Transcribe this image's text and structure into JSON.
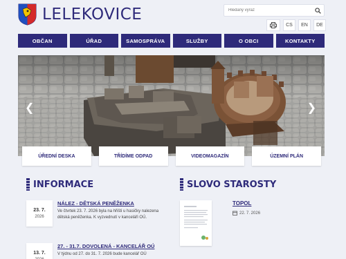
{
  "header": {
    "title": "LELEKOVICE",
    "search_placeholder": "Hledaný výraz",
    "languages": [
      "CS",
      "EN",
      "DE"
    ]
  },
  "nav": {
    "items": [
      "OBČAN",
      "ÚŘAD",
      "SAMOSPRÁVA",
      "SLUŽBY",
      "O OBCI",
      "KONTAKTY"
    ]
  },
  "quick_links": [
    "ÚŘEDNÍ DESKA",
    "TŘÍDÍME ODPAD",
    "VIDEOMAGAZÍN",
    "ÚZEMNÍ PLÁN"
  ],
  "informace": {
    "title": "INFORMACE",
    "items": [
      {
        "day": "23. 7.",
        "year": "2026",
        "title": "NÁLEZ - DĚTSKÁ PENĚŽENKA",
        "text": "Ve čtvrtek 23. 7. 2026 byla na hřišti u hasičky nalezena dětská peněženka. K vyzvednutí v kanceláři OÚ."
      },
      {
        "day": "13. 7.",
        "year": "2026",
        "title": "27. - 31.7. DOVOLENÁ - KANCELÁŘ OÚ",
        "text": "V týdnu od 27. do 31. 7. 2026 bude kancelář OÚ"
      }
    ]
  },
  "starosta": {
    "title": "SLOVO STAROSTY",
    "item_title": "TOPOL",
    "item_date": "22. 7. 2026"
  },
  "colors": {
    "brand": "#2e2a7a",
    "background": "#eef0f6"
  }
}
